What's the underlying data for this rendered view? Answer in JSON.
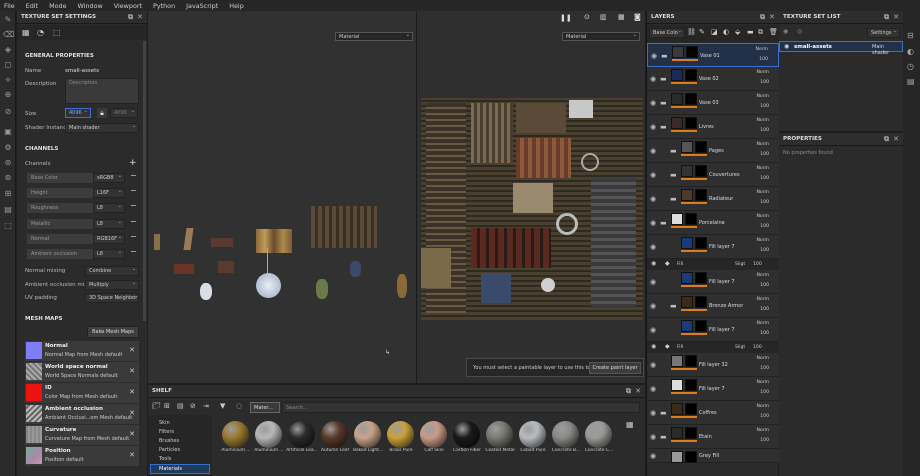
{
  "menu": [
    "File",
    "Edit",
    "Mode",
    "Window",
    "Viewport",
    "Python",
    "JavaScript",
    "Help"
  ],
  "texture_set_settings": {
    "title": "TEXTURE SET SETTINGS",
    "general_heading": "GENERAL PROPERTIES",
    "name_label": "Name",
    "name_value": "small-assets",
    "description_label": "Description",
    "description_placeholder": "Description",
    "size_label": "Size",
    "size_w": "4096",
    "size_h": "4096",
    "shader_label": "Shader Instance",
    "shader_value": "Main shader",
    "channels_heading": "CHANNELS",
    "channels_label": "Channels",
    "channels": [
      {
        "name": "Base Color",
        "format": "sRGB8"
      },
      {
        "name": "Height",
        "format": "L16F"
      },
      {
        "name": "Roughness",
        "format": "L8"
      },
      {
        "name": "Metallic",
        "format": "L8"
      },
      {
        "name": "Normal",
        "format": "RGB16F"
      },
      {
        "name": "Ambient occlusion",
        "format": "L8"
      }
    ],
    "normal_mixing_label": "Normal mixing",
    "normal_mixing_value": "Combine",
    "ao_mixing_label": "Ambient occlusion mixing",
    "ao_mixing_value": "Multiply",
    "uv_padding_label": "UV padding",
    "uv_padding_value": "3D Space Neighbor",
    "mesh_maps_heading": "MESH MAPS",
    "bake_button": "Bake Mesh Maps",
    "mesh_maps": [
      {
        "title": "Normal",
        "sub": "Normal Map from Mesh default",
        "color": "#7d7ef5"
      },
      {
        "title": "World space normal",
        "sub": "World Space Normals default",
        "color": "#8a8a8a"
      },
      {
        "title": "ID",
        "sub": "Color Map from Mesh default",
        "color": "#ee1111"
      },
      {
        "title": "Ambient occlusion",
        "sub": "Ambient Occlusi...om Mesh default",
        "color": "#9a9a9a"
      },
      {
        "title": "Curvature",
        "sub": "Curvature Map from Mesh default",
        "color": "#808080"
      },
      {
        "title": "Position",
        "sub": "Position default",
        "color": "#9b7fa0"
      }
    ]
  },
  "viewport": {
    "left_mode": "Material",
    "right_mode": "Material",
    "warning": "You must select a paintable layer to use this tool",
    "create_paint_layer": "Create paint layer"
  },
  "layers": {
    "title": "LAYERS",
    "channel_select": "Base Colo",
    "items": [
      {
        "name": "Vase 01",
        "blend": "Norm",
        "opacity": "100",
        "folder": true
      },
      {
        "name": "Vase 02",
        "blend": "Norm",
        "opacity": "100",
        "folder": true
      },
      {
        "name": "Vase 03",
        "blend": "Norm",
        "opacity": "100",
        "folder": true
      },
      {
        "name": "Livres",
        "blend": "Norm",
        "opacity": "100",
        "folder": true
      },
      {
        "name": "Pages",
        "blend": "Norm",
        "opacity": "100",
        "folder": true
      },
      {
        "name": "Couvertures",
        "blend": "Norm",
        "opacity": "100",
        "folder": true
      },
      {
        "name": "Radiateur",
        "blend": "Norm",
        "opacity": "100",
        "folder": true
      },
      {
        "name": "Porcelaine",
        "blend": "Norm",
        "opacity": "100",
        "folder": true
      },
      {
        "name": "Fill layer 7",
        "blend": "Norm",
        "opacity": "100",
        "folder": false
      },
      {
        "name": "Fill layer 7",
        "blend": "Norm",
        "opacity": "100",
        "folder": false
      },
      {
        "name": "Bronze Armor",
        "blend": "Norm",
        "opacity": "100",
        "folder": true
      },
      {
        "name": "Fill layer 7",
        "blend": "Norm",
        "opacity": "100",
        "folder": false
      },
      {
        "name": "Fill layer 32",
        "blend": "Norm",
        "opacity": "100",
        "folder": false
      },
      {
        "name": "Fill layer 7",
        "blend": "Norm",
        "opacity": "100",
        "folder": false
      },
      {
        "name": "Coffres",
        "blend": "Norm",
        "opacity": "100",
        "folder": true
      },
      {
        "name": "Etain",
        "blend": "Norm",
        "opacity": "100",
        "folder": true
      },
      {
        "name": "Grey Fill",
        "blend": "",
        "opacity": "",
        "folder": false
      }
    ],
    "fx": {
      "name": "Fill",
      "blend": "Sligt",
      "opacity": "100"
    }
  },
  "texture_set_list": {
    "title": "TEXTURE SET LIST",
    "settings_button": "Settings",
    "item": "small-assets",
    "shader": "Main shader"
  },
  "properties": {
    "title": "PROPERTIES",
    "empty": "No properties found"
  },
  "shelf": {
    "title": "SHELF",
    "filter_tag": "Mater...",
    "search_placeholder": "Search...",
    "categories": [
      "Skin",
      "Filters",
      "Brushes",
      "Particles",
      "Tools",
      "Materials"
    ],
    "materials": [
      {
        "name": "Aluminium ...",
        "color": "#9a7a30"
      },
      {
        "name": "Aluminium ...",
        "color": "#b8b8b8"
      },
      {
        "name": "Artificial Lea...",
        "color": "#2a2a2a"
      },
      {
        "name": "Autumn Leaf",
        "color": "#5a3a2a"
      },
      {
        "name": "Baked Light...",
        "color": "#c9a38a"
      },
      {
        "name": "Brass Pure",
        "color": "#c9a13a"
      },
      {
        "name": "Calf Skin",
        "color": "#c99a88"
      },
      {
        "name": "Carbon Fiber",
        "color": "#1a1a1a"
      },
      {
        "name": "Coated Metal",
        "color": "#7a7a70"
      },
      {
        "name": "Cobalt Pure",
        "color": "#b8bcc0"
      },
      {
        "name": "Concrete B...",
        "color": "#8a8a88"
      },
      {
        "name": "Concrete C...",
        "color": "#9a9a98"
      }
    ]
  }
}
